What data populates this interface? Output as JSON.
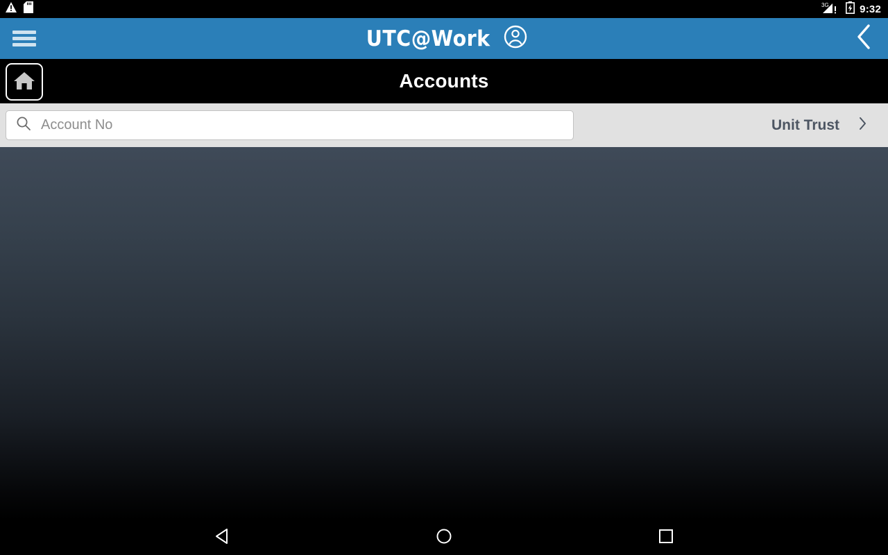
{
  "statusbar": {
    "warning_icon": "warning-triangle-icon",
    "sd_icon": "sd-card-icon",
    "signal_label": "3G",
    "signal_icon": "signal-3g-icon",
    "battery_icon": "battery-icon",
    "time": "9:32"
  },
  "appbar": {
    "menu_icon": "hamburger-menu-icon",
    "brand_title": "UTC@Work",
    "account_icon": "account-person-icon",
    "back_icon": "chevron-left-icon",
    "background_color": "#2b7fb8"
  },
  "titlebar": {
    "home_icon": "home-icon",
    "title": "Accounts",
    "background_color": "#000000"
  },
  "searchbar": {
    "search_icon": "search-icon",
    "placeholder": "Account No",
    "value": "",
    "filter_label": "Unit Trust",
    "filter_chevron_icon": "chevron-right-icon",
    "background_color": "#e1e1e1",
    "filter_text_color": "#4c5562"
  },
  "content": {
    "gradient_top_color": "#3f4a58",
    "gradient_bottom_color": "#000000"
  },
  "navbar": {
    "back_icon": "nav-back-triangle-icon",
    "home_icon": "nav-home-circle-icon",
    "recents_icon": "nav-recents-square-icon"
  }
}
